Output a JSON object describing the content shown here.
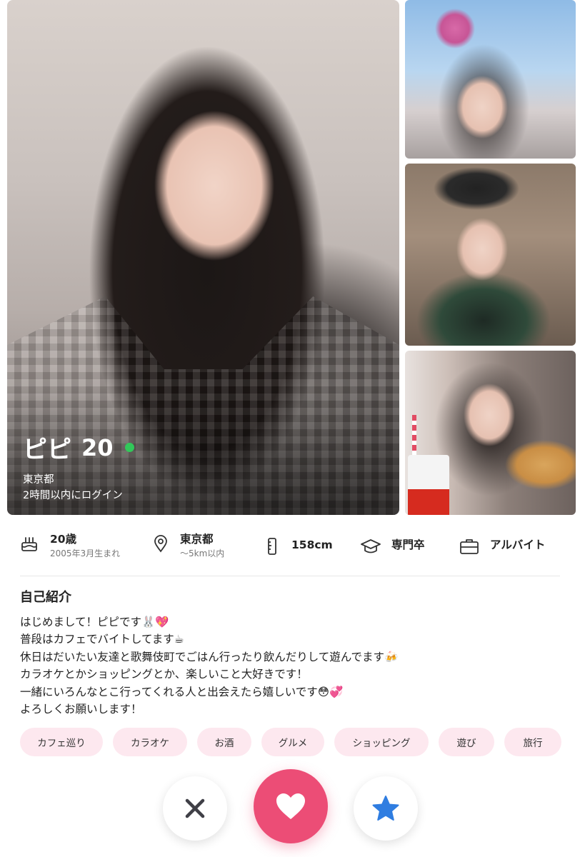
{
  "profile": {
    "name": "ピピ",
    "age": "20",
    "location": "東京都",
    "last_login": "2時間以内にログイン",
    "online_color": "#32c85a"
  },
  "info": [
    {
      "icon": "cake-icon",
      "main": "20歳",
      "sub": "2005年3月生まれ"
    },
    {
      "icon": "location-pin-icon",
      "main": "東京都",
      "sub": "〜5km以内"
    },
    {
      "icon": "height-icon",
      "main": "158cm",
      "sub": ""
    },
    {
      "icon": "graduation-cap-icon",
      "main": "専門卒",
      "sub": ""
    },
    {
      "icon": "briefcase-icon",
      "main": "アルバイト",
      "sub": ""
    }
  ],
  "intro": {
    "title": "自己紹介",
    "lines": [
      "はじめまして！ピピです🐰💖",
      "普段はカフェでバイトしてます☕",
      "休日はだいたい友達と歌舞伎町でごはん行ったり飲んだりして遊んでます🍻",
      "カラオケとかショッピングとか、楽しいこと大好きです！",
      "一緒にいろんなとこ行ってくれる人と出会えたら嬉しいです😳💞",
      "よろしくお願いします！"
    ]
  },
  "tags": [
    "カフェ巡り",
    "カラオケ",
    "お酒",
    "グルメ",
    "ショッピング",
    "遊び",
    "旅行"
  ],
  "actions": {
    "pass_icon": "close-icon",
    "like_icon": "heart-icon",
    "super_icon": "star-icon",
    "like_color": "#ec4d76",
    "star_color": "#2f7de1"
  },
  "colors": {
    "tag_bg": "#fde8ef",
    "accent": "#ec4d76"
  }
}
